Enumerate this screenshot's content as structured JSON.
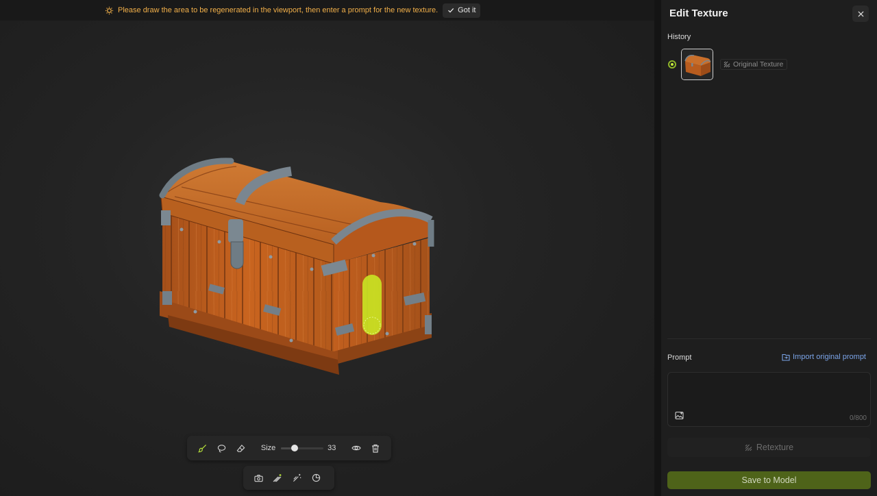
{
  "notice": {
    "text": "Please draw the area to be regenerated in the viewport, then enter a prompt for the new texture.",
    "got_it_label": "Got it"
  },
  "viewport": {
    "model": "treasure-chest",
    "selection_color": "#c9e623"
  },
  "toolbar": {
    "size_label": "Size",
    "size_value": "33",
    "size_fraction": 0.33,
    "tools": [
      "brush-icon",
      "lasso-icon",
      "eraser-icon",
      "eye-icon",
      "trash-icon"
    ],
    "secondary_tools": [
      "camera-icon",
      "magic-paint-icon",
      "magic-wand-icon",
      "material-icon"
    ]
  },
  "panel": {
    "title": "Edit Texture",
    "history_label": "History",
    "history_items": [
      {
        "label": "Original Texture",
        "selected": true
      }
    ],
    "prompt_label": "Prompt",
    "import_label": "Import original prompt",
    "prompt_value": "",
    "counter": "0/800",
    "retexture_label": "Retexture",
    "save_label": "Save to Model"
  },
  "colors": {
    "accent": "#c7ef3c",
    "warning": "#f2b04a",
    "link": "#7ba4e8",
    "save_button": "#4e6319"
  }
}
